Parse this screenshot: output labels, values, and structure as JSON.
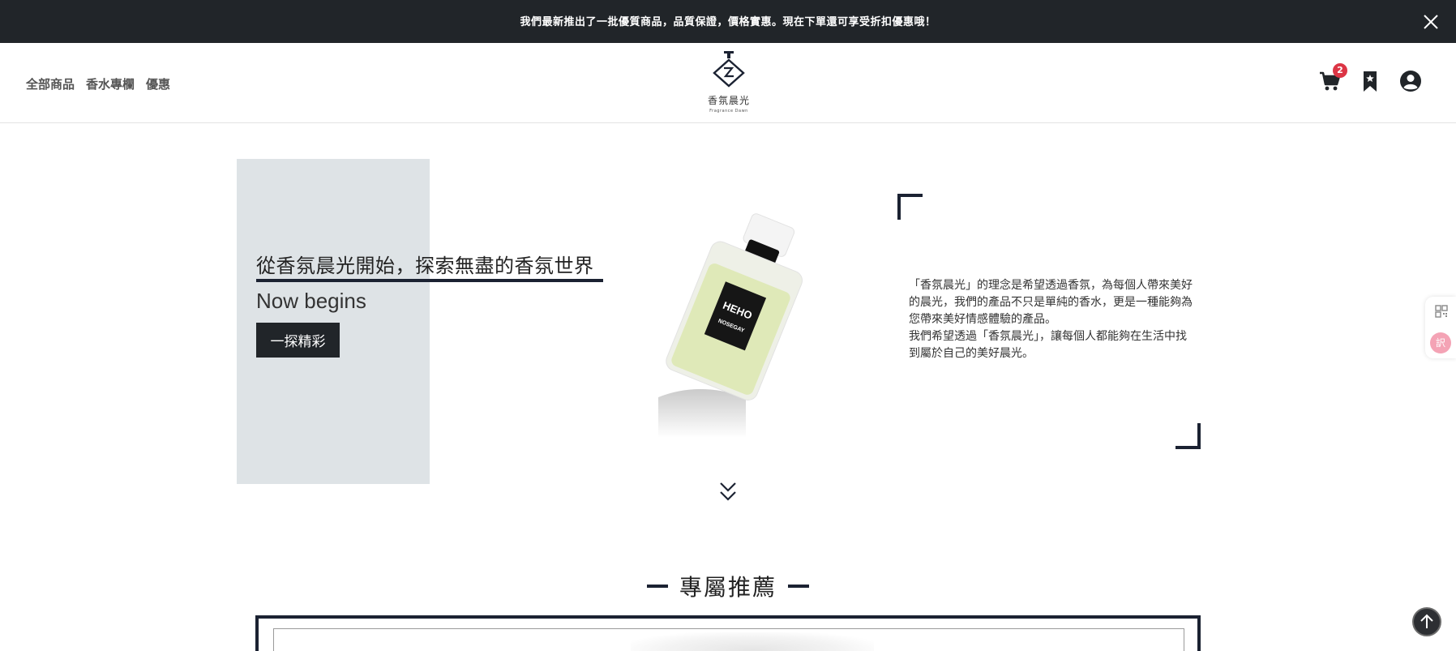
{
  "announcement": {
    "text": "我們最新推出了一批優質商品，品質保證，價格實惠。現在下單還可享受折扣優惠哦！"
  },
  "nav": {
    "items": [
      "全部商品",
      "香水專欄",
      "優惠"
    ]
  },
  "logo": {
    "name": "香氛晨光",
    "subtitle": "Fragrance Dawn"
  },
  "cart": {
    "count": "2"
  },
  "hero": {
    "title": "從香氛晨光開始，探索無盡的香氛世界",
    "subtitle": "Now begins",
    "button_label": "一探精彩",
    "bottle_label_top": "HEHO",
    "bottle_label_bottom": "NOSEGAY"
  },
  "about": {
    "paragraph1": "「香氛晨光」的理念是希望透過香氛，為每個人帶來美好的晨光，我們的產品不只是單純的香水，更是一種能夠為您帶來美好情感體驗的產品。",
    "paragraph2": "我們希望透過「香氛晨光」，讓每個人都能夠在生活中找到屬於自己的美好晨光。"
  },
  "featured": {
    "title": "專屬推薦"
  },
  "side_tool": {
    "translate_label": "訳"
  },
  "colors": {
    "dark": "#212529",
    "navy": "#1b2232",
    "panel": "#dee3e6",
    "badge": "#dc3545"
  }
}
